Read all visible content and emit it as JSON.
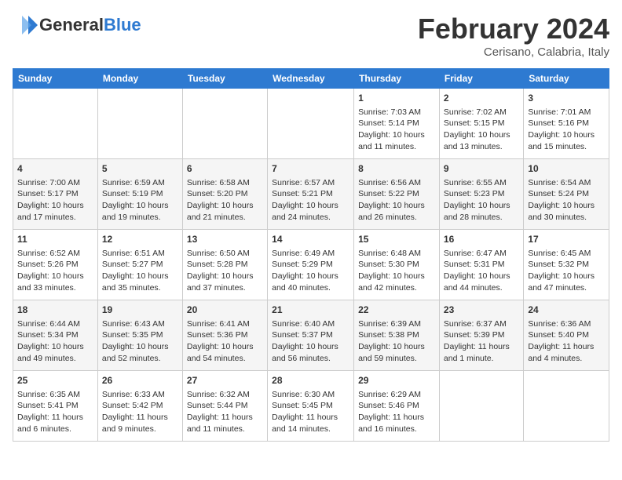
{
  "header": {
    "logo_general": "General",
    "logo_blue": "Blue",
    "month": "February 2024",
    "location": "Cerisano, Calabria, Italy"
  },
  "days_of_week": [
    "Sunday",
    "Monday",
    "Tuesday",
    "Wednesday",
    "Thursday",
    "Friday",
    "Saturday"
  ],
  "weeks": [
    [
      {
        "day": "",
        "info": ""
      },
      {
        "day": "",
        "info": ""
      },
      {
        "day": "",
        "info": ""
      },
      {
        "day": "",
        "info": ""
      },
      {
        "day": "1",
        "info": "Sunrise: 7:03 AM\nSunset: 5:14 PM\nDaylight: 10 hours and 11 minutes."
      },
      {
        "day": "2",
        "info": "Sunrise: 7:02 AM\nSunset: 5:15 PM\nDaylight: 10 hours and 13 minutes."
      },
      {
        "day": "3",
        "info": "Sunrise: 7:01 AM\nSunset: 5:16 PM\nDaylight: 10 hours and 15 minutes."
      }
    ],
    [
      {
        "day": "4",
        "info": "Sunrise: 7:00 AM\nSunset: 5:17 PM\nDaylight: 10 hours and 17 minutes."
      },
      {
        "day": "5",
        "info": "Sunrise: 6:59 AM\nSunset: 5:19 PM\nDaylight: 10 hours and 19 minutes."
      },
      {
        "day": "6",
        "info": "Sunrise: 6:58 AM\nSunset: 5:20 PM\nDaylight: 10 hours and 21 minutes."
      },
      {
        "day": "7",
        "info": "Sunrise: 6:57 AM\nSunset: 5:21 PM\nDaylight: 10 hours and 24 minutes."
      },
      {
        "day": "8",
        "info": "Sunrise: 6:56 AM\nSunset: 5:22 PM\nDaylight: 10 hours and 26 minutes."
      },
      {
        "day": "9",
        "info": "Sunrise: 6:55 AM\nSunset: 5:23 PM\nDaylight: 10 hours and 28 minutes."
      },
      {
        "day": "10",
        "info": "Sunrise: 6:54 AM\nSunset: 5:24 PM\nDaylight: 10 hours and 30 minutes."
      }
    ],
    [
      {
        "day": "11",
        "info": "Sunrise: 6:52 AM\nSunset: 5:26 PM\nDaylight: 10 hours and 33 minutes."
      },
      {
        "day": "12",
        "info": "Sunrise: 6:51 AM\nSunset: 5:27 PM\nDaylight: 10 hours and 35 minutes."
      },
      {
        "day": "13",
        "info": "Sunrise: 6:50 AM\nSunset: 5:28 PM\nDaylight: 10 hours and 37 minutes."
      },
      {
        "day": "14",
        "info": "Sunrise: 6:49 AM\nSunset: 5:29 PM\nDaylight: 10 hours and 40 minutes."
      },
      {
        "day": "15",
        "info": "Sunrise: 6:48 AM\nSunset: 5:30 PM\nDaylight: 10 hours and 42 minutes."
      },
      {
        "day": "16",
        "info": "Sunrise: 6:47 AM\nSunset: 5:31 PM\nDaylight: 10 hours and 44 minutes."
      },
      {
        "day": "17",
        "info": "Sunrise: 6:45 AM\nSunset: 5:32 PM\nDaylight: 10 hours and 47 minutes."
      }
    ],
    [
      {
        "day": "18",
        "info": "Sunrise: 6:44 AM\nSunset: 5:34 PM\nDaylight: 10 hours and 49 minutes."
      },
      {
        "day": "19",
        "info": "Sunrise: 6:43 AM\nSunset: 5:35 PM\nDaylight: 10 hours and 52 minutes."
      },
      {
        "day": "20",
        "info": "Sunrise: 6:41 AM\nSunset: 5:36 PM\nDaylight: 10 hours and 54 minutes."
      },
      {
        "day": "21",
        "info": "Sunrise: 6:40 AM\nSunset: 5:37 PM\nDaylight: 10 hours and 56 minutes."
      },
      {
        "day": "22",
        "info": "Sunrise: 6:39 AM\nSunset: 5:38 PM\nDaylight: 10 hours and 59 minutes."
      },
      {
        "day": "23",
        "info": "Sunrise: 6:37 AM\nSunset: 5:39 PM\nDaylight: 11 hours and 1 minute."
      },
      {
        "day": "24",
        "info": "Sunrise: 6:36 AM\nSunset: 5:40 PM\nDaylight: 11 hours and 4 minutes."
      }
    ],
    [
      {
        "day": "25",
        "info": "Sunrise: 6:35 AM\nSunset: 5:41 PM\nDaylight: 11 hours and 6 minutes."
      },
      {
        "day": "26",
        "info": "Sunrise: 6:33 AM\nSunset: 5:42 PM\nDaylight: 11 hours and 9 minutes."
      },
      {
        "day": "27",
        "info": "Sunrise: 6:32 AM\nSunset: 5:44 PM\nDaylight: 11 hours and 11 minutes."
      },
      {
        "day": "28",
        "info": "Sunrise: 6:30 AM\nSunset: 5:45 PM\nDaylight: 11 hours and 14 minutes."
      },
      {
        "day": "29",
        "info": "Sunrise: 6:29 AM\nSunset: 5:46 PM\nDaylight: 11 hours and 16 minutes."
      },
      {
        "day": "",
        "info": ""
      },
      {
        "day": "",
        "info": ""
      }
    ]
  ]
}
